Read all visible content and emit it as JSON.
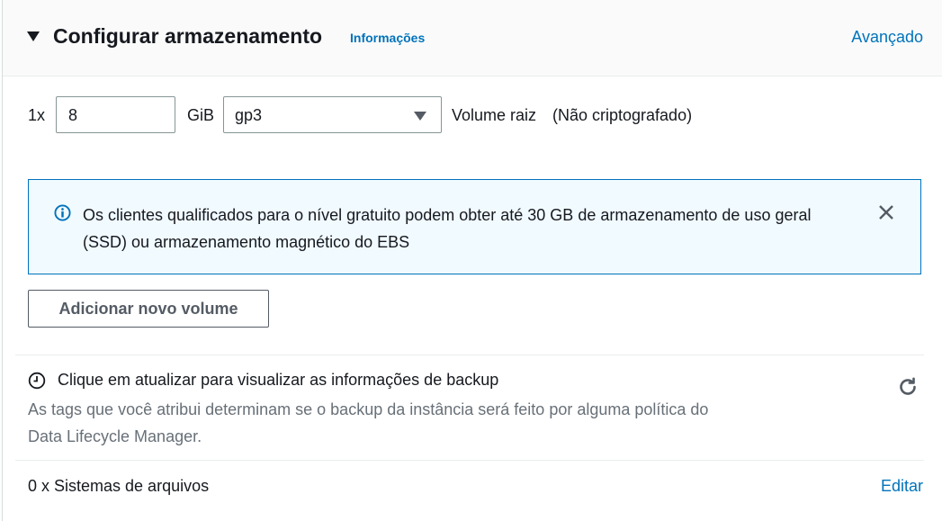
{
  "section": {
    "title": "Configurar armazenamento",
    "info_link": "Informações",
    "advanced_link": "Avançado"
  },
  "volume": {
    "count_label": "1x",
    "size_value": "8",
    "unit_label": "GiB",
    "type_selected": "gp3",
    "volume_label": "Volume raiz",
    "encryption_label": "(Não criptografado)"
  },
  "alert": {
    "text": "Os clientes qualificados para o nível gratuito podem obter até 30 GB de armazenamento de uso geral (SSD) ou armazenamento magnético do EBS",
    "accent_color": "#0073bb"
  },
  "add_volume_button": "Adicionar novo volume",
  "backup": {
    "title": "Clique em atualizar para visualizar as informações de backup",
    "description": "As tags que você atribui determinam se o backup da instância será feito por alguma política do Data Lifecycle Manager."
  },
  "file_systems": {
    "label": "0 x Sistemas de arquivos",
    "edit_link": "Editar"
  },
  "icons": [
    "caret-down-icon",
    "info-icon",
    "close-icon",
    "clock-icon",
    "refresh-icon",
    "dropdown-arrow-icon"
  ]
}
